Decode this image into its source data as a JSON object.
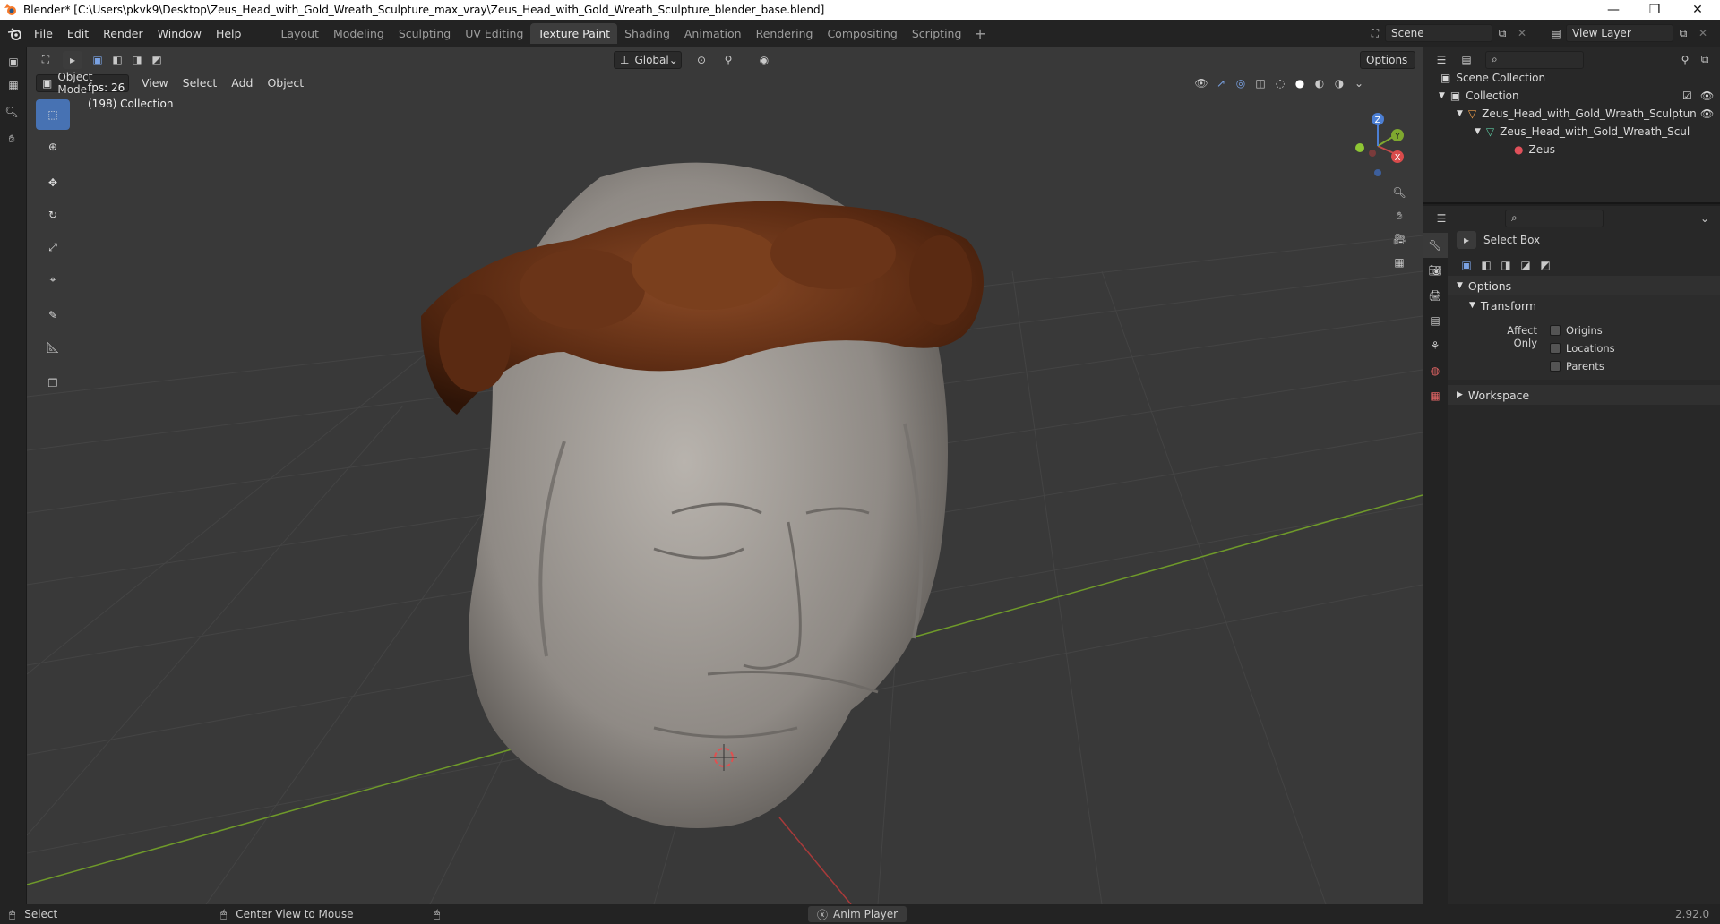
{
  "window": {
    "title": "Blender* [C:\\Users\\pkvk9\\Desktop\\Zeus_Head_with_Gold_Wreath_Sculpture_max_vray\\Zeus_Head_with_Gold_Wreath_Sculpture_blender_base.blend]",
    "minimize_glyph": "—",
    "restore_glyph": "❐",
    "close_glyph": "✕"
  },
  "menubar": {
    "menus": [
      "File",
      "Edit",
      "Render",
      "Window",
      "Help"
    ],
    "workspace_tabs": [
      "Layout",
      "Modeling",
      "Sculpting",
      "UV Editing",
      "Texture Paint",
      "Shading",
      "Animation",
      "Rendering",
      "Compositing",
      "Scripting"
    ],
    "active_tab": "Texture Paint",
    "add_tab_glyph": "+",
    "scene_name": "Scene",
    "view_layer_name": "View Layer"
  },
  "viewport": {
    "mode": "Object Mode",
    "menus": [
      "View",
      "Select",
      "Add",
      "Object"
    ],
    "transform_orientation": "Global",
    "options_label": "Options",
    "fps_text": "fps: 26",
    "collection_text": "(198) Collection",
    "gizmo_axes": {
      "x": "X",
      "y": "Y",
      "z": "Z"
    },
    "colors": {
      "background": "#393939",
      "grid_line": "#444444",
      "x_axis": "#a83a3a",
      "y_axis": "#6f9a2a",
      "active_tool": "#4772b3"
    },
    "tools": [
      "select-box-tool",
      "cursor-tool",
      "move-tool",
      "rotate-tool",
      "scale-tool",
      "transform-tool",
      "annotate-tool",
      "measure-tool",
      "add-cube-tool"
    ]
  },
  "outliner": {
    "root": "Scene Collection",
    "collection": "Collection",
    "object": "Zeus_Head_with_Gold_Wreath_Sculptun",
    "mesh": "Zeus_Head_with_Gold_Wreath_Scul",
    "material": "Zeus"
  },
  "properties": {
    "tool_name": "Select Box",
    "options_panel": "Options",
    "transform_subpanel": "Transform",
    "affect_only_label": "Affect Only",
    "checkboxes": [
      "Origins",
      "Locations",
      "Parents"
    ],
    "workspace_panel": "Workspace"
  },
  "statusbar": {
    "left_action": "Select",
    "middle_action": "Center View to Mouse",
    "center_item": "Anim Player",
    "version": "2.92.0"
  }
}
